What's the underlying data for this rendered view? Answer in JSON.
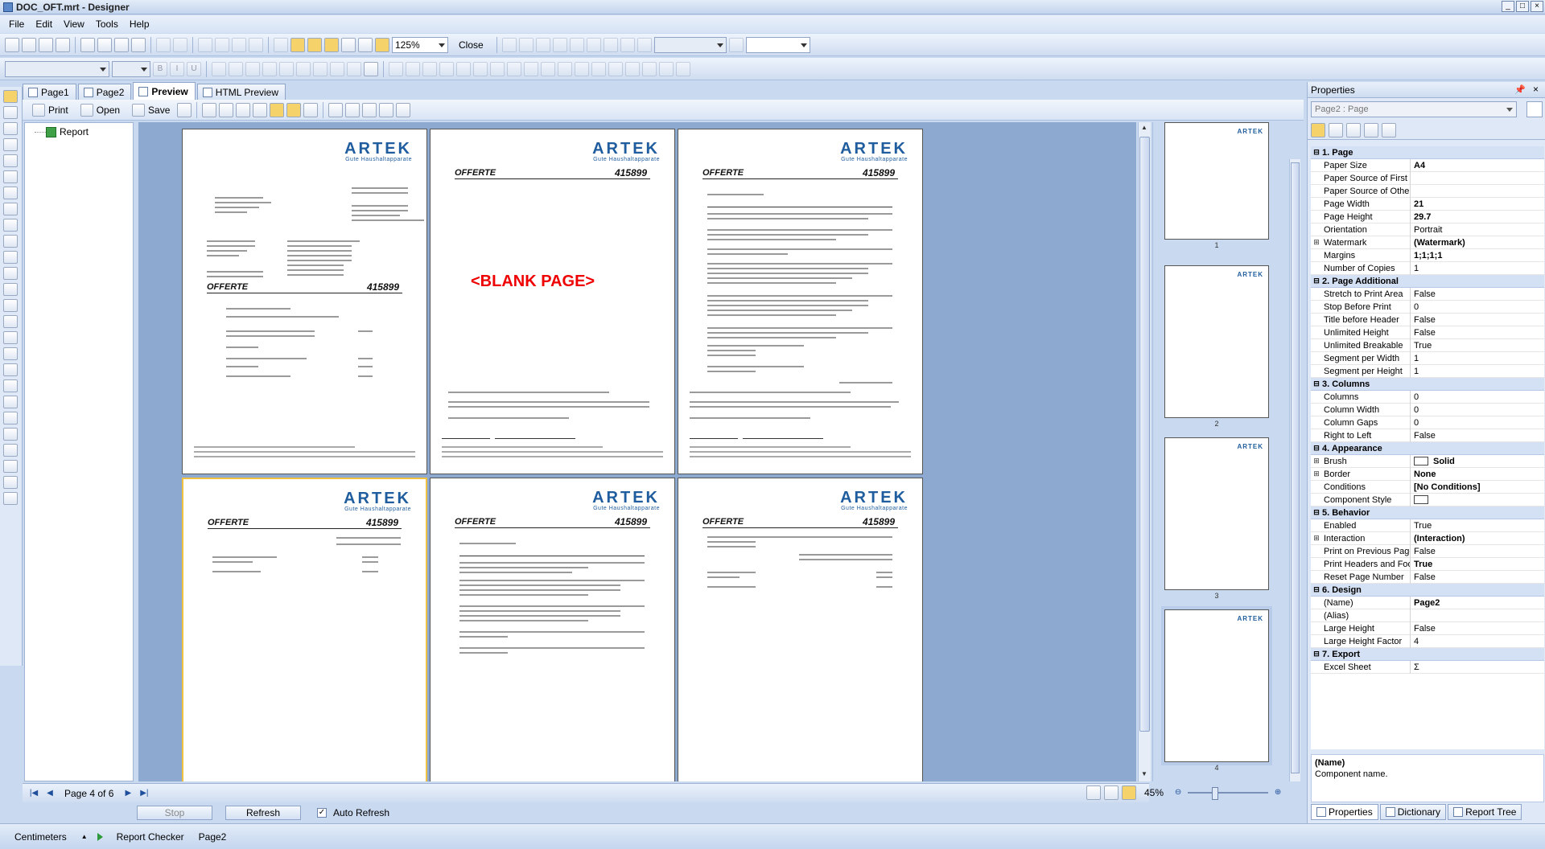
{
  "window": {
    "title": "DOC_OFT.mrt - Designer"
  },
  "menu": [
    "File",
    "Edit",
    "View",
    "Tools",
    "Help"
  ],
  "toolbar": {
    "zoom": "125%",
    "close": "Close"
  },
  "tabs": [
    {
      "label": "Page1"
    },
    {
      "label": "Page2"
    },
    {
      "label": "Preview"
    },
    {
      "label": "HTML Preview"
    }
  ],
  "preview_toolbar": {
    "print": "Print",
    "open": "Open",
    "save": "Save"
  },
  "tree": {
    "root": "Report"
  },
  "pages": {
    "brand": "ARTEK",
    "tagline": "Gute Haushaltapparate",
    "doc_title": "OFFERTE",
    "doc_number": "415899",
    "blank": "<BLANK PAGE>"
  },
  "thumbnails": [
    "1",
    "2",
    "3",
    "4"
  ],
  "nav": {
    "page_of": "Page 4 of 6",
    "zoom": "45%"
  },
  "bottom": {
    "stop": "Stop",
    "refresh": "Refresh",
    "auto_refresh": "Auto Refresh"
  },
  "statusbar": {
    "units": "Centimeters",
    "checker": "Report Checker",
    "page": "Page2"
  },
  "properties": {
    "header": "Properties",
    "object": "Page2 : Page",
    "categories": [
      {
        "name": "1. Page",
        "rows": [
          {
            "name": "Paper Size",
            "value": "A4",
            "bold": true
          },
          {
            "name": "Paper Source of First",
            "value": ""
          },
          {
            "name": "Paper Source of Other",
            "value": ""
          },
          {
            "name": "Page Width",
            "value": "21",
            "bold": true
          },
          {
            "name": "Page Height",
            "value": "29.7",
            "bold": true
          },
          {
            "name": "Orientation",
            "value": "Portrait"
          },
          {
            "name": "Watermark",
            "value": "(Watermark)",
            "bold": true,
            "exp": true
          },
          {
            "name": "Margins",
            "value": "1;1;1;1",
            "bold": true
          },
          {
            "name": "Number of Copies",
            "value": "1"
          }
        ]
      },
      {
        "name": "2. Page  Additional",
        "rows": [
          {
            "name": "Stretch to Print Area",
            "value": "False"
          },
          {
            "name": "Stop Before Print",
            "value": "0"
          },
          {
            "name": "Title before Header",
            "value": "False"
          },
          {
            "name": "Unlimited Height",
            "value": "False"
          },
          {
            "name": "Unlimited Breakable",
            "value": "True"
          },
          {
            "name": "Segment per Width",
            "value": "1"
          },
          {
            "name": "Segment per Height",
            "value": "1"
          }
        ]
      },
      {
        "name": "3. Columns",
        "rows": [
          {
            "name": "Columns",
            "value": "0"
          },
          {
            "name": "Column Width",
            "value": "0"
          },
          {
            "name": "Column Gaps",
            "value": "0"
          },
          {
            "name": "Right to Left",
            "value": "False"
          }
        ]
      },
      {
        "name": "4. Appearance",
        "rows": [
          {
            "name": "Brush",
            "value": "Solid",
            "bold": true,
            "exp": true,
            "swatch": true
          },
          {
            "name": "Border",
            "value": "None",
            "bold": true,
            "exp": true
          },
          {
            "name": "Conditions",
            "value": "[No Conditions]",
            "bold": true
          },
          {
            "name": "Component Style",
            "value": "",
            "swatch": true
          }
        ]
      },
      {
        "name": "5. Behavior",
        "rows": [
          {
            "name": "Enabled",
            "value": "True"
          },
          {
            "name": "Interaction",
            "value": "(Interaction)",
            "bold": true,
            "exp": true
          },
          {
            "name": "Print on Previous Page",
            "value": "False"
          },
          {
            "name": "Print Headers and Foo",
            "value": "True",
            "bold": true
          },
          {
            "name": "Reset Page Number",
            "value": "False"
          }
        ]
      },
      {
        "name": "6. Design",
        "rows": [
          {
            "name": "(Name)",
            "value": "Page2",
            "bold": true
          },
          {
            "name": "(Alias)",
            "value": ""
          },
          {
            "name": "Large Height",
            "value": "False"
          },
          {
            "name": "Large Height Factor",
            "value": "4"
          }
        ]
      },
      {
        "name": "7. Export",
        "rows": [
          {
            "name": "Excel Sheet",
            "value": "Σ"
          }
        ]
      }
    ],
    "description": {
      "name": "(Name)",
      "text": "Component name."
    },
    "tabs": [
      "Properties",
      "Dictionary",
      "Report Tree"
    ]
  }
}
